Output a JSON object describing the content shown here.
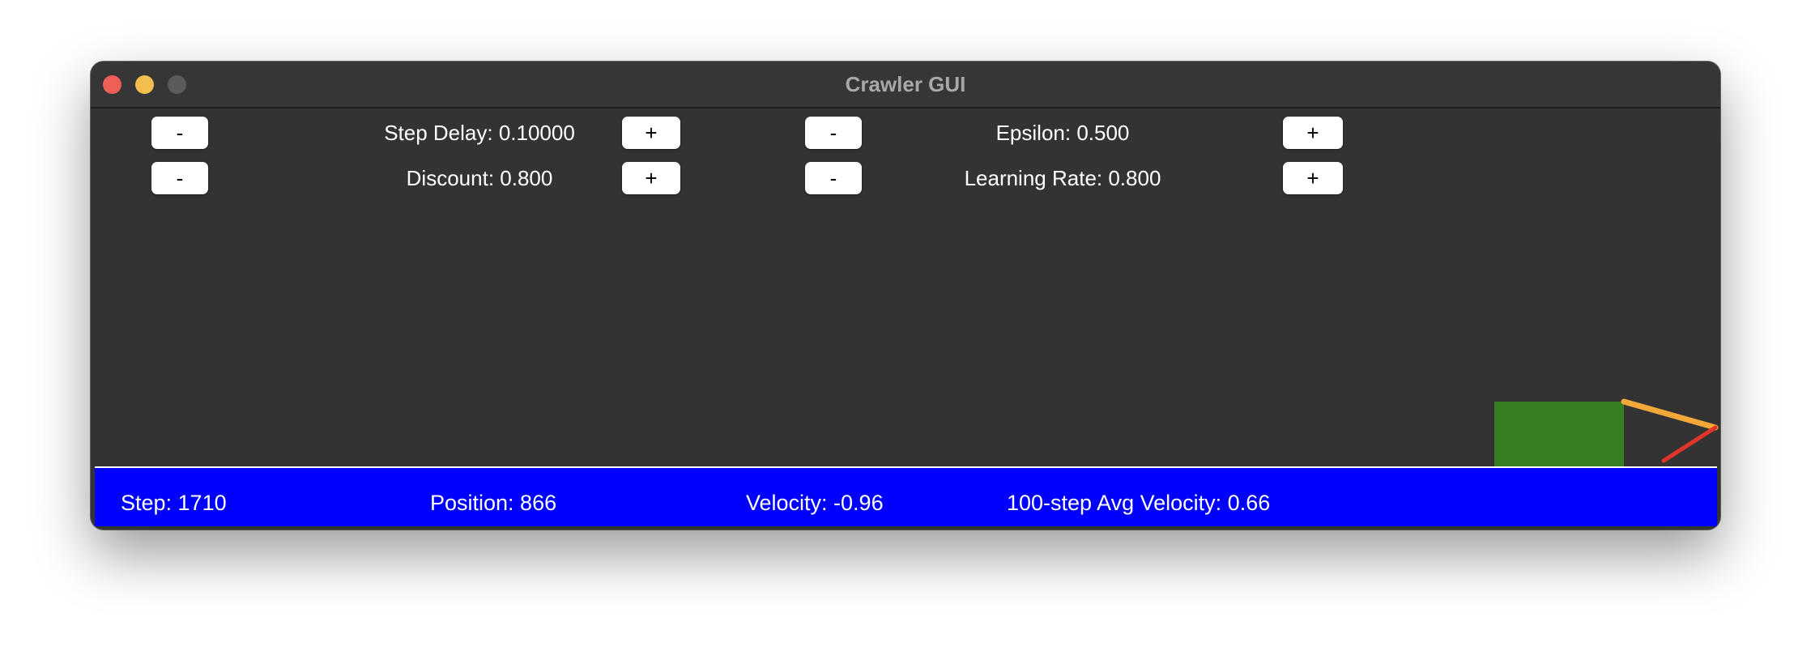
{
  "window": {
    "title": "Crawler GUI"
  },
  "controls": {
    "step_delay": {
      "minus": "-",
      "label": "Step Delay: 0.10000",
      "plus": "+"
    },
    "epsilon": {
      "minus": "-",
      "label": "Epsilon: 0.500",
      "plus": "+"
    },
    "discount": {
      "minus": "-",
      "label": "Discount: 0.800",
      "plus": "+"
    },
    "learning_rate": {
      "minus": "-",
      "label": "Learning Rate: 0.800",
      "plus": "+"
    }
  },
  "status": {
    "step": "Step: 1710",
    "position": "Position: 866",
    "velocity": "Velocity: -0.96",
    "avg_velocity": "100-step Avg Velocity: 0.66"
  },
  "colors": {
    "background": "#333333",
    "status_bar": "#0000ff",
    "crawler_body": "#377d22",
    "arm": "#f4a83a",
    "hand": "#e0362a"
  }
}
